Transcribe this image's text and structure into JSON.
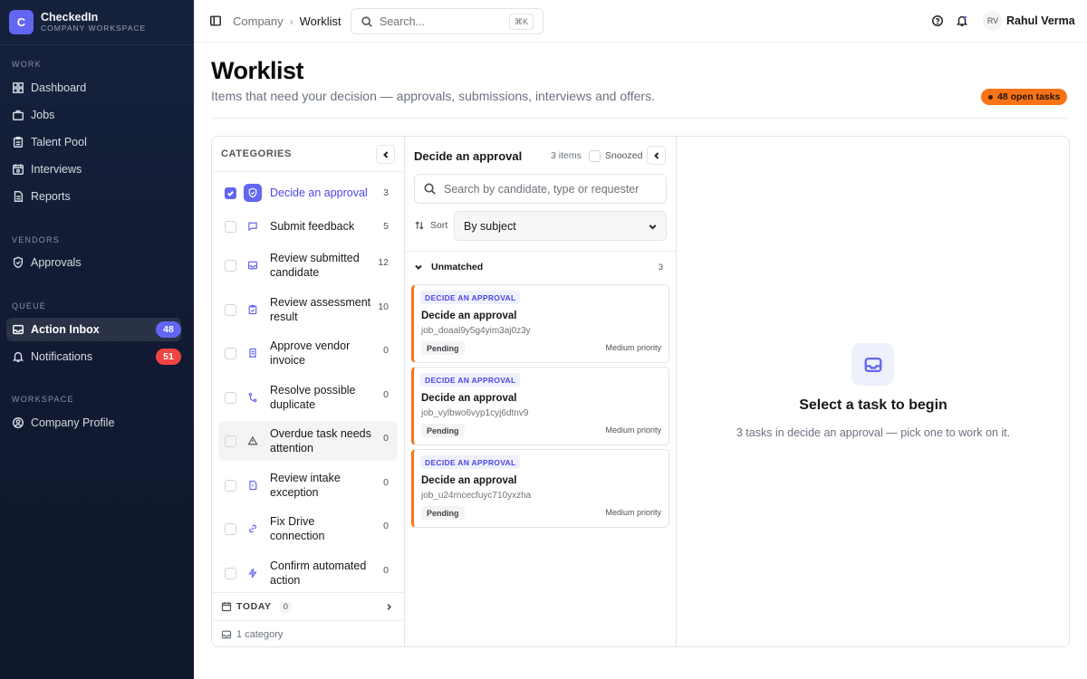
{
  "brand": {
    "initial": "C",
    "name": "CheckedIn",
    "subtitle": "COMPANY WORKSPACE"
  },
  "sidebar": {
    "sections": [
      {
        "title": "WORK",
        "items": [
          {
            "label": "Dashboard",
            "icon": "grid-icon"
          },
          {
            "label": "Jobs",
            "icon": "briefcase-icon"
          },
          {
            "label": "Talent Pool",
            "icon": "clipboard-icon"
          },
          {
            "label": "Interviews",
            "icon": "calendar-icon"
          },
          {
            "label": "Reports",
            "icon": "file-icon"
          }
        ]
      },
      {
        "title": "VENDORS",
        "items": [
          {
            "label": "Approvals",
            "icon": "shield-icon"
          }
        ]
      },
      {
        "title": "QUEUE",
        "items": [
          {
            "label": "Action Inbox",
            "icon": "inbox-icon",
            "badge": "48",
            "badge_color": "#6366f1",
            "active": true
          },
          {
            "label": "Notifications",
            "icon": "bell-icon",
            "badge": "51",
            "badge_color": "#ef4444"
          }
        ]
      },
      {
        "title": "WORKSPACE",
        "items": [
          {
            "label": "Company Profile",
            "icon": "user-circle-icon"
          }
        ]
      }
    ]
  },
  "topbar": {
    "breadcrumb": [
      "Company",
      "Worklist"
    ],
    "search_placeholder": "Search...",
    "search_shortcut": "⌘K",
    "user_initials": "RV",
    "user_name": "Rahul Verma"
  },
  "page": {
    "title": "Worklist",
    "subtitle": "Items that need your decision — approvals, submissions, interviews and offers.",
    "open_tasks_badge": "48 open tasks",
    "accent_color": "#f97316"
  },
  "categories": {
    "title": "CATEGORIES",
    "items": [
      {
        "label": "Decide an approval",
        "count": "3",
        "checked": true,
        "icon": "shield-icon"
      },
      {
        "label": "Submit feedback",
        "count": "5",
        "checked": false,
        "icon": "message-icon"
      },
      {
        "label": "Review submitted candidate",
        "count": "12",
        "checked": false,
        "icon": "inbox-icon"
      },
      {
        "label": "Review assessment result",
        "count": "10",
        "checked": false,
        "icon": "clipboard-check-icon"
      },
      {
        "label": "Approve vendor invoice",
        "count": "0",
        "checked": false,
        "icon": "receipt-icon"
      },
      {
        "label": "Resolve possible duplicate",
        "count": "0",
        "checked": false,
        "icon": "merge-icon"
      },
      {
        "label": "Overdue task needs attention",
        "count": "0",
        "checked": false,
        "icon": "alert-triangle-icon"
      },
      {
        "label": "Review intake exception",
        "count": "0",
        "checked": false,
        "icon": "file-alert-icon"
      },
      {
        "label": "Fix Drive connection",
        "count": "0",
        "checked": false,
        "icon": "link-icon"
      },
      {
        "label": "Confirm automated action",
        "count": "0",
        "checked": false,
        "icon": "zap-icon"
      }
    ],
    "today_label": "TODAY",
    "today_count": "0",
    "footer_text": "1 category"
  },
  "task_list": {
    "title": "Decide an approval",
    "count_text": "3 items",
    "snoozed_label": "Snoozed",
    "search_placeholder": "Search by candidate, type or requester",
    "sort_label": "Sort",
    "sort_value": "By subject",
    "group_title": "Unmatched",
    "group_count": "3",
    "tasks": [
      {
        "tag": "DECIDE AN APPROVAL",
        "title": "Decide an approval",
        "id": "job_doaal9y5g4yim3aj0z3y",
        "status": "Pending",
        "priority": "Medium priority"
      },
      {
        "tag": "DECIDE AN APPROVAL",
        "title": "Decide an approval",
        "id": "job_vylbwo6vyp1cyj6dtnv9",
        "status": "Pending",
        "priority": "Medium priority"
      },
      {
        "tag": "DECIDE AN APPROVAL",
        "title": "Decide an approval",
        "id": "job_u24rncecfuyc710yxzha",
        "status": "Pending",
        "priority": "Medium priority"
      }
    ]
  },
  "detail": {
    "empty_title": "Select a task to begin",
    "empty_subtitle": "3 tasks in decide an approval — pick one to work on it."
  }
}
